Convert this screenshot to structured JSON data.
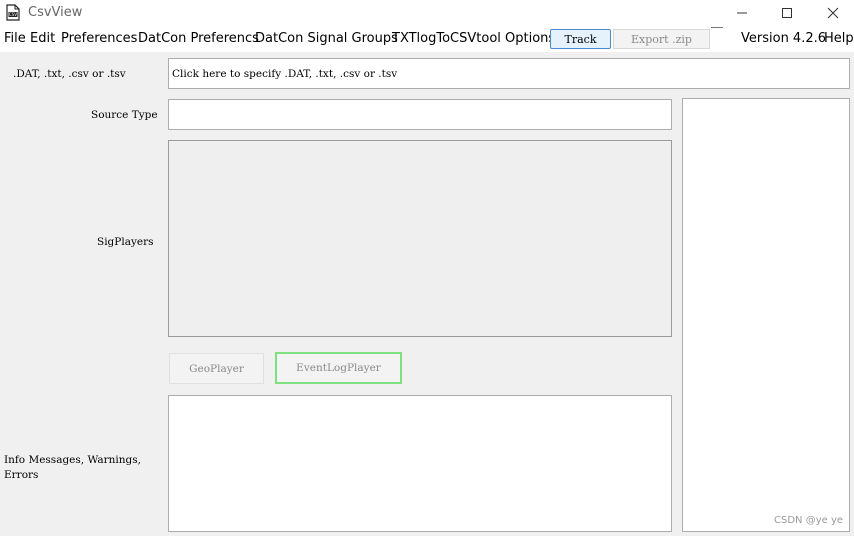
{
  "window": {
    "title": "CsvView",
    "icon": "csvview-document-icon"
  },
  "menu": {
    "file": "File",
    "edit": "Edit",
    "preferences": "Preferences",
    "datcon_preferences": "DatCon Preferencs",
    "datcon_signal_groups": "DatCon Signal Groups",
    "txtlog_options": "TXTlogToCSVtool Options",
    "help": "Help"
  },
  "toolbar": {
    "track_label": "Track",
    "export_label": "Export .zip"
  },
  "version": "Version 4.2.6",
  "form": {
    "file_label": ".DAT, .txt, .csv or .tsv",
    "file_value": "Click here to specify .DAT, .txt, .csv or .tsv",
    "source_type_label": "Source Type",
    "source_type_value": "",
    "sigplayers_label": "SigPlayers",
    "geoplayer_label": "GeoPlayer",
    "eventlogplayer_label": "EventLogPlayer",
    "info_label": "Info Messages, Warnings, Errors",
    "info_value": ""
  },
  "watermark": "CSDN @ye ye",
  "colors": {
    "accent_border": "#4a8bd4",
    "eventlog_focus": "#7ee07e",
    "window_bg": "#f0f0f0"
  }
}
